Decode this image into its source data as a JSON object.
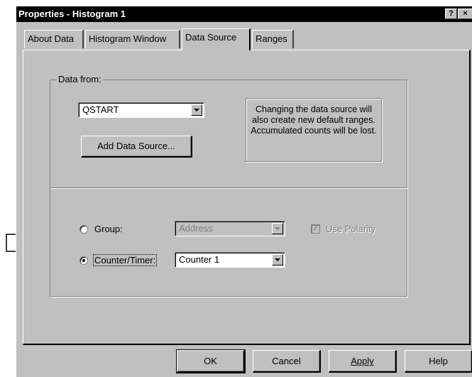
{
  "window": {
    "title": "Properties - Histogram 1",
    "help_button": "?",
    "close_button": "×"
  },
  "tabs": [
    {
      "label": "About Data",
      "active": false
    },
    {
      "label": "Histogram Window",
      "active": false
    },
    {
      "label": "Data Source",
      "active": true
    },
    {
      "label": "Ranges",
      "active": false
    }
  ],
  "data_from": {
    "label": "Data from:",
    "source_value": "QSTART",
    "add_button": "Add Data Source...",
    "note": "Changing the data source will also create new default ranges. Accumulated counts will be lost."
  },
  "options": {
    "group_label": "Group:",
    "group_value": "Address",
    "group_selected": false,
    "counter_label": "Counter/Timer:",
    "counter_value": "Counter 1",
    "counter_selected": true,
    "use_polarity_label": "Use Polarity",
    "use_polarity_checked": true
  },
  "buttons": {
    "ok": "OK",
    "cancel": "Cancel",
    "apply": "Apply",
    "help": "Help"
  }
}
